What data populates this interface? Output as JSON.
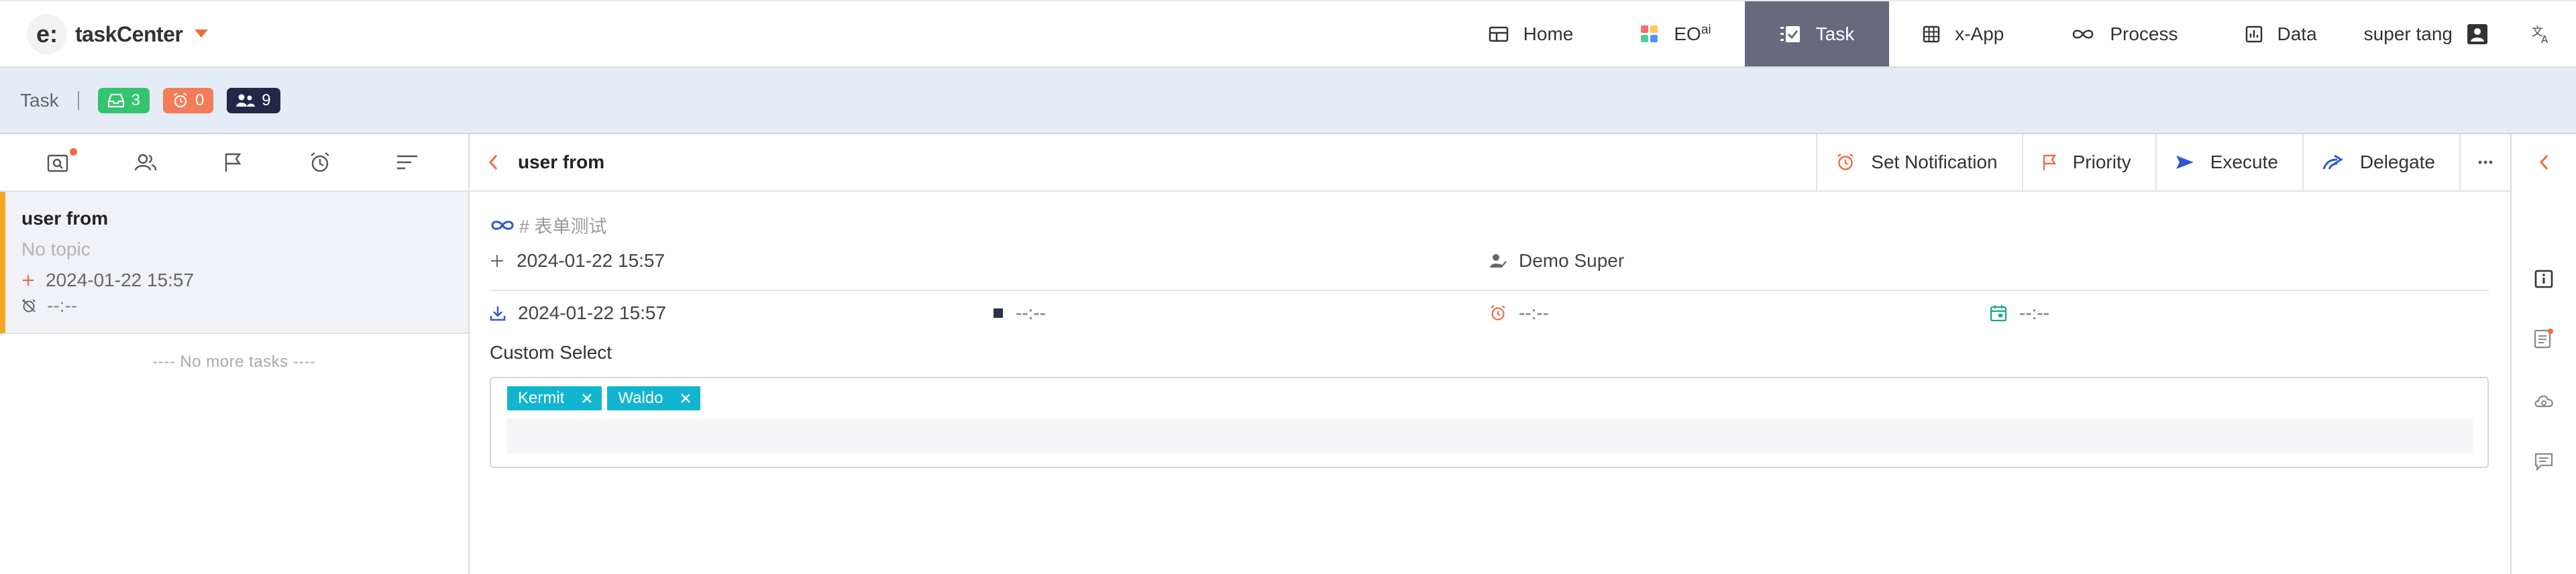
{
  "app": {
    "logo_letter": "e:",
    "name": "taskCenter"
  },
  "nav": {
    "items": [
      {
        "label": "Home",
        "icon": "home-grid-icon"
      },
      {
        "label": "EO",
        "sup": "ai",
        "icon": "eo-tiles-icon"
      },
      {
        "label": "Task",
        "icon": "task-checklist-icon",
        "active": true
      },
      {
        "label": "x-App",
        "icon": "apps-grid-icon"
      },
      {
        "label": "Process",
        "icon": "infinity-link-icon"
      },
      {
        "label": "Data",
        "icon": "bar-chart-icon"
      }
    ],
    "user_name": "super tang",
    "user_icon": "user-badge-icon",
    "translate_icon": "translate-icon"
  },
  "subbar": {
    "title": "Task",
    "badges": [
      {
        "count": "3",
        "icon": "inbox-icon",
        "color": "#33c46e"
      },
      {
        "count": "0",
        "icon": "alarm-icon",
        "color": "#f27c5a"
      },
      {
        "count": "9",
        "icon": "group-icon",
        "color": "#232848"
      }
    ]
  },
  "left": {
    "tools": [
      "search-task-icon",
      "people-icon",
      "flag-icon",
      "alarm-clock-icon",
      "sort-icon"
    ],
    "task": {
      "title": "user from",
      "topic": "No topic",
      "created": "2024-01-22 15:57",
      "deadline": "--:--"
    },
    "no_more": "----   No more tasks   ----"
  },
  "main": {
    "title": "user from",
    "actions": [
      {
        "label": "Set Notification",
        "icon": "alarm-icon"
      },
      {
        "label": "Priority",
        "icon": "flag-icon"
      },
      {
        "label": "Execute",
        "icon": "send-icon"
      },
      {
        "label": "Delegate",
        "icon": "delegate-arrow-icon"
      }
    ],
    "topic_tag": "# 表单测试",
    "created": "2024-01-22 15:57",
    "creator": "Demo Super",
    "received": "2024-01-22 15:57",
    "status_time": "--:--",
    "alarm_time": "--:--",
    "calendar_time": "--:--",
    "custom_select": {
      "label": "Custom Select",
      "selected": [
        "Kermit",
        "Waldo"
      ]
    }
  },
  "rail": {
    "icons": [
      "collapse-chevron-icon",
      "info-icon",
      "form-icon",
      "cloud-icon",
      "comment-icon"
    ]
  },
  "colors": {
    "accent": "#68687e",
    "orange": "#f26a3d",
    "chip": "#12b5d0",
    "blue": "#2f56d6"
  }
}
